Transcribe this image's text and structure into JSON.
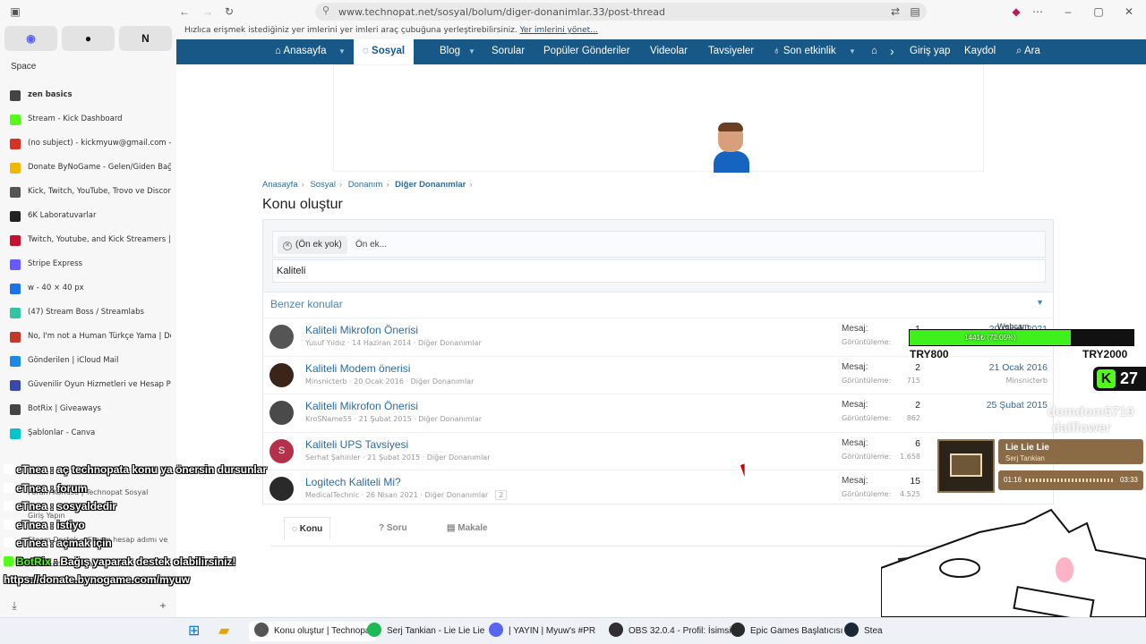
{
  "browser": {
    "url": "www.technopat.net/sosyal/bolum/diger-donanimlar.33/post-thread",
    "bookmarks_message": "Hızlıca erişmek istediğiniz yer imlerini yer imleri araç çubuğuna yerleştirebilirsiniz.",
    "bookmarks_link": "Yer imlerini yönet..."
  },
  "sidebar": {
    "space_label": "Space",
    "pins": [
      "discord-icon",
      "github-icon",
      "notion-icon"
    ],
    "tabs": [
      {
        "label": "zen basics",
        "icon_color": "#444444",
        "bold": true
      },
      {
        "label": "Stream - Kick Dashboard",
        "icon_color": "#53fc18"
      },
      {
        "label": "(no subject) - kickmyuw@gmail.com - G",
        "icon_color": "#d93025"
      },
      {
        "label": "Donate ByNoGame - Gelen/Giden Bağ",
        "icon_color": "#f2b705"
      },
      {
        "label": "Kick, Twitch, YouTube, Trovo ve Discord",
        "icon_color": "#555555"
      },
      {
        "label": "6K Laboratuvarlar",
        "icon_color": "#222222"
      },
      {
        "label": "Twitch, Youtube, and Kick Streamers | T",
        "icon_color": "#c8102e"
      },
      {
        "label": "Stripe Express",
        "icon_color": "#635bff"
      },
      {
        "label": "w - 40 × 40 px",
        "icon_color": "#1a73e8"
      },
      {
        "label": "(47) Stream Boss / Streamlabs",
        "icon_color": "#31c3a2"
      },
      {
        "label": "No, I'm not a Human Türkçe Yama | Dc",
        "icon_color": "#c0392b"
      },
      {
        "label": "Gönderilen | iCloud Mail",
        "icon_color": "#1e88e5"
      },
      {
        "label": "Güvenilir Oyun Hizmetleri ve Hesap Paz",
        "icon_color": "#3949ab"
      },
      {
        "label": "BotRix | Giveaways",
        "icon_color": "#444444"
      },
      {
        "label": "Şablonlar - Canva",
        "icon_color": "#00c4cc"
      }
    ],
    "hidden_tabs": [
      "Forum Konusu | Technopat Sosyal",
      "Giriş Yapın",
      "Steam Destek :: Steam hesap adımı ve",
      "Sunucu bulunamadı"
    ]
  },
  "chat": [
    {
      "user": "eTnea",
      "message": "aç technopata konu ya önersin dursunlar"
    },
    {
      "user": "eTnea",
      "message": "forum"
    },
    {
      "user": "eTnea",
      "message": "sosyaldedir"
    },
    {
      "user": "eTnea",
      "message": "istiyo"
    },
    {
      "user": "eTnea",
      "message": "açmak için"
    },
    {
      "user": "BotRix",
      "message": "Bağış yaparak destek olabilirsiniz!"
    },
    {
      "user": "",
      "message": "https://donate.bynogame.com/myuw"
    }
  ],
  "navbar": {
    "home": "Anasayfa",
    "social": "Sosyal",
    "blog": "Blog",
    "questions": "Sorular",
    "popular": "Popüler Gönderiler",
    "videos": "Videolar",
    "recommendations": "Tavsiyeler",
    "recent": "Son etkinlik",
    "login": "Giriş yap",
    "register": "Kaydol",
    "search": "Ara"
  },
  "breadcrumb": [
    "Anasayfa",
    "Sosyal",
    "Donanım",
    "Diğer Donanımlar"
  ],
  "page_title": "Konu oluştur",
  "form": {
    "prefix_chip": "(Ön ek yok)",
    "prefix_placeholder": "Ön ek...",
    "title_value": "Kaliteli"
  },
  "similar": {
    "heading": "Benzer konular",
    "message_label": "Mesaj:",
    "views_label": "Görüntüleme:",
    "threads": [
      {
        "title": "Kaliteli Mikrofon Önerisi",
        "author": "Yusuf Yıldız",
        "date": "14 Haziran 2014",
        "forum": "Diğer Donanımlar",
        "replies": "1",
        "views": "",
        "last_date": "20 Ocak 2021",
        "last_user": "",
        "avatar_color": "#555555",
        "avatar_letter": ""
      },
      {
        "title": "Kaliteli Modem önerisi",
        "author": "Minsnicterb",
        "date": "20 Ocak 2016",
        "forum": "Diğer Donanımlar",
        "replies": "2",
        "views": "715",
        "last_date": "21 Ocak 2016",
        "last_user": "Minsnicterb",
        "avatar_color": "#3b2418",
        "avatar_letter": ""
      },
      {
        "title": "Kaliteli Mikrofon Önerisi",
        "author": "KroSName55",
        "date": "21 Şubat 2015",
        "forum": "Diğer Donanımlar",
        "replies": "2",
        "views": "862",
        "last_date": "25 Şubat 2015",
        "last_user": "",
        "avatar_color": "#4a4a4a",
        "avatar_letter": ""
      },
      {
        "title": "Kaliteli UPS Tavsiyesi",
        "author": "Serhat Şahinler",
        "date": "21 Şubat 2015",
        "forum": "Diğer Donanımlar",
        "replies": "6",
        "views": "1.658",
        "last_date": "",
        "last_user": "",
        "avatar_color": "#b5304a",
        "avatar_letter": "S"
      },
      {
        "title": "Logitech Kaliteli Mi?",
        "author": "MedicalTechnic",
        "date": "26 Nisan 2021",
        "forum": "Diğer Donanımlar",
        "replies": "15",
        "views": "4.525",
        "last_date": "",
        "last_user": "",
        "avatar_color": "#2a2a2a",
        "avatar_letter": ""
      }
    ],
    "extra_badge": "2"
  },
  "content_tabs": [
    "Konu",
    "Soru",
    "Makale"
  ],
  "overlays": {
    "goal_label": "Webcam",
    "goal_text": "1441₺ (72.05%)",
    "goal_fraction": 0.7205,
    "goal_min": "TRY800",
    "goal_max": "TRY2000",
    "kick_count": "27",
    "ghost_names": [
      "domdom5719",
      "dalflower"
    ],
    "song": "Lie Lie Lie",
    "artist": "Serj Tankian",
    "time_elapsed": "01:16",
    "time_total": "03:33"
  },
  "taskbar": {
    "items": [
      {
        "label": "Konu oluştur | Technopa",
        "icon": "browser-icon",
        "color": "#555555"
      },
      {
        "label": "Serj Tankian - Lie Lie Lie",
        "icon": "spotify-icon",
        "color": "#1db954"
      },
      {
        "label": "| YAYIN | Myuw's #PR",
        "icon": "discord-icon",
        "color": "#5865f2"
      },
      {
        "label": "OBS 32.0.4 - Profil: İsimsi",
        "icon": "obs-icon",
        "color": "#302e31"
      },
      {
        "label": "Epic Games Başlatıcısı",
        "icon": "epic-icon",
        "color": "#2a2a2a"
      },
      {
        "label": "Stea",
        "icon": "steam-icon",
        "color": "#1b2838"
      }
    ]
  },
  "colors": {
    "nav": "#185886",
    "link": "#2b6ca0",
    "accent_green": "#53fc18"
  }
}
